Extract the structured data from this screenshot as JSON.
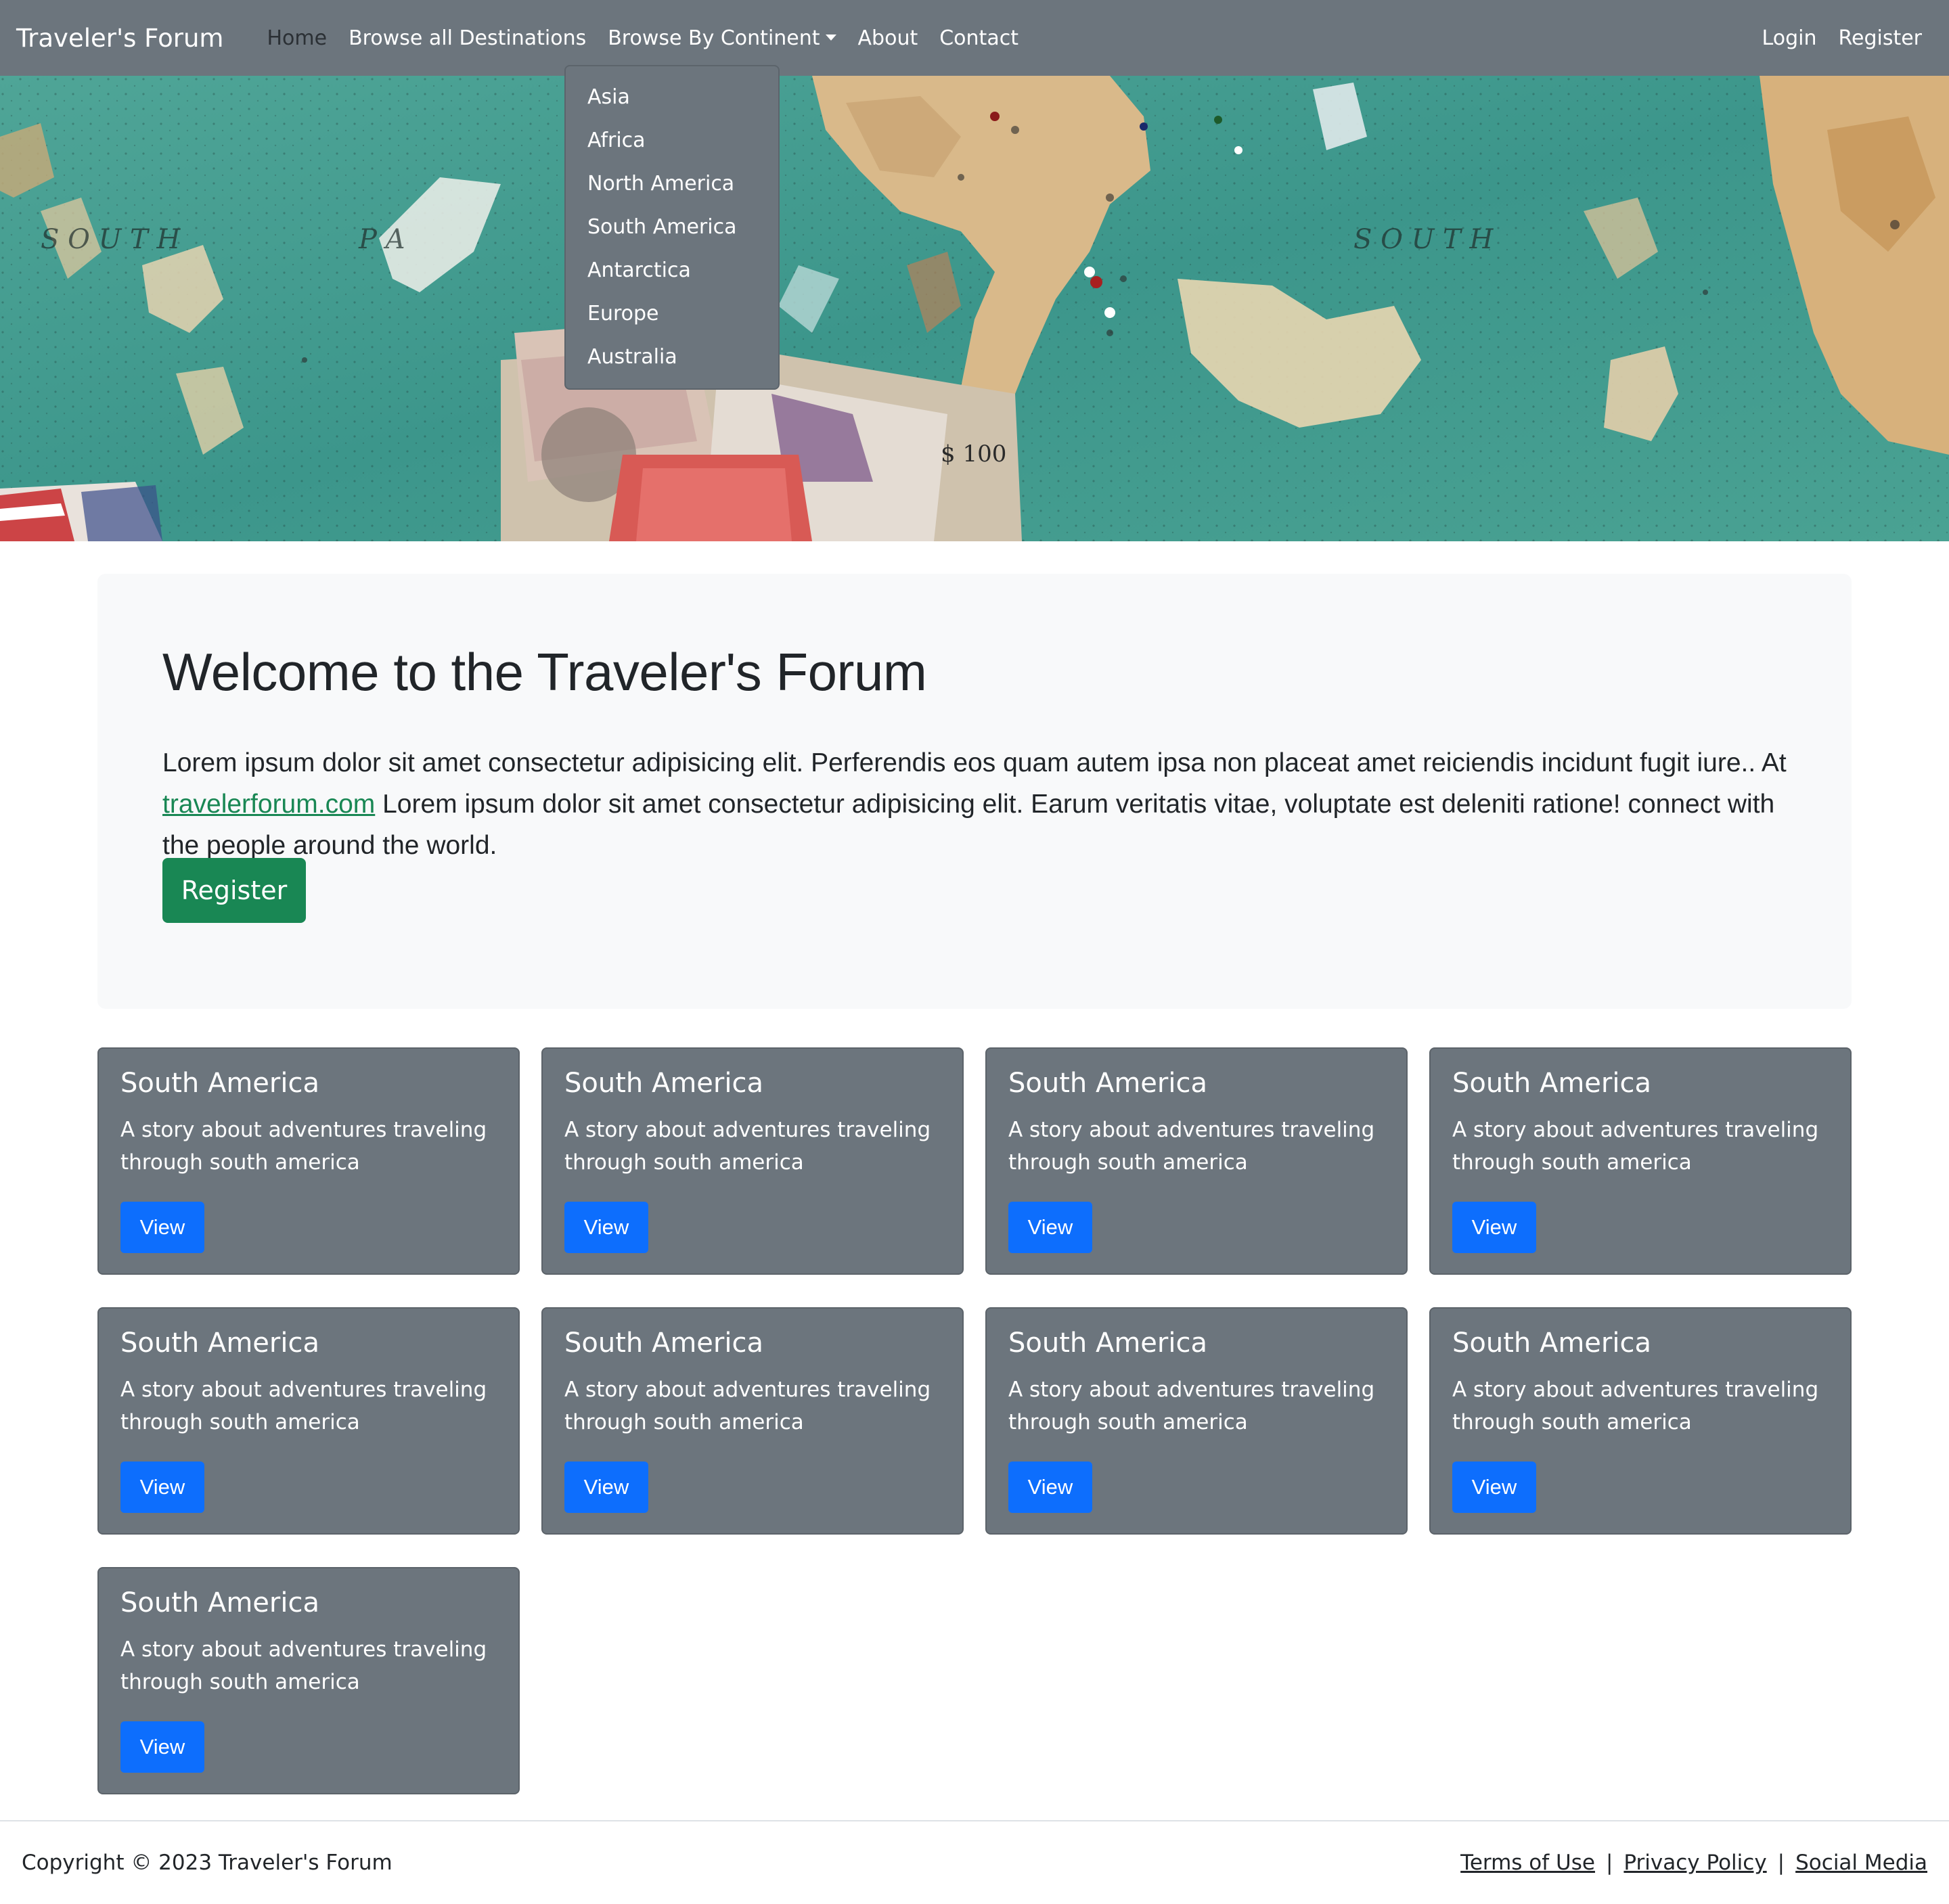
{
  "navbar": {
    "brand": "Traveler's Forum",
    "links": {
      "home": "Home",
      "browse_all": "Browse all Destinations",
      "browse_continent": "Browse By Continent",
      "about": "About",
      "contact": "Contact"
    },
    "login": "Login",
    "register": "Register"
  },
  "dropdown": {
    "items": [
      "Asia",
      "Africa",
      "North America",
      "South America",
      "Antarctica",
      "Europe",
      "Australia"
    ]
  },
  "jumbotron": {
    "title": "Welcome to the Traveler's Forum",
    "text_before_link": "Lorem ipsum dolor sit amet consectetur adipisicing elit. Perferendis eos quam autem ipsa non placeat amet reiciendis incidunt fugit iure.. At ",
    "link_text": "travelerforum.com",
    "text_after_link": " Lorem ipsum dolor sit amet consectetur adipisicing elit. Earum veritatis vitae, voluptate est deleniti ratione! connect with the people around the world.",
    "button": "Register"
  },
  "cards": [
    {
      "title": "South America",
      "text": "A story about adventures traveling through south america",
      "button": "View"
    },
    {
      "title": "South America",
      "text": "A story about adventures traveling through south america",
      "button": "View"
    },
    {
      "title": "South America",
      "text": "A story about adventures traveling through south america",
      "button": "View"
    },
    {
      "title": "South America",
      "text": "A story about adventures traveling through south america",
      "button": "View"
    },
    {
      "title": "South America",
      "text": "A story about adventures traveling through south america",
      "button": "View"
    },
    {
      "title": "South America",
      "text": "A story about adventures traveling through south america",
      "button": "View"
    },
    {
      "title": "South America",
      "text": "A story about adventures traveling through south america",
      "button": "View"
    },
    {
      "title": "South America",
      "text": "A story about adventures traveling through south america",
      "button": "View"
    },
    {
      "title": "South America",
      "text": "A story about adventures traveling through south america",
      "button": "View"
    }
  ],
  "footer": {
    "copyright": "Copyright © 2023 Traveler's Forum",
    "links": [
      "Terms of Use",
      "Privacy Policy",
      "Social Media"
    ],
    "separator": "|"
  },
  "hero": {
    "map_labels": [
      "S O U T H",
      "P A",
      "S O U T H"
    ],
    "banknote_text": "$ 100"
  },
  "colors": {
    "navbar": "#6c757d",
    "card": "#6c757d",
    "register_button": "#198754",
    "view_button": "#0d6efd",
    "link": "#198754",
    "jumbotron_bg": "#f8f9fa"
  }
}
